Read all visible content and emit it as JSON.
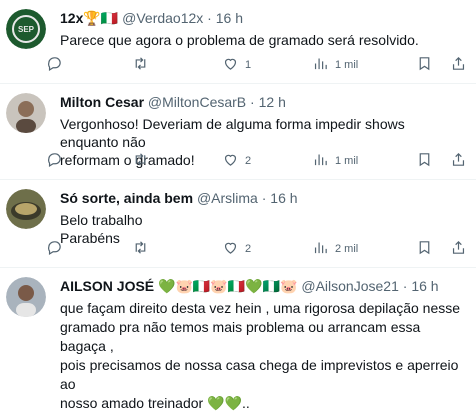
{
  "tweets": [
    {
      "name": "12x🏆🇮🇹",
      "handle": "@Verdao12x",
      "time": "16 h",
      "text": [
        "Parece que agora o problema de gramado será resolvido."
      ],
      "replies": "",
      "retweets": "",
      "likes": "1",
      "views": "1 mil"
    },
    {
      "name": "Milton Cesar",
      "handle": "@MiltonCesarB",
      "time": "12 h",
      "text": [
        "Vergonhoso! Deveriam de alguma forma impedir shows enquanto não",
        "reformam o gramado!"
      ],
      "replies": "",
      "retweets": "",
      "likes": "2",
      "views": "1 mil"
    },
    {
      "name": "Só sorte, ainda bem",
      "handle": "@Arslima",
      "time": "16 h",
      "text": [
        "Belo trabalho",
        "Parabéns"
      ],
      "replies": "",
      "retweets": "",
      "likes": "2",
      "views": "2 mil"
    },
    {
      "name": "AILSON JOSÉ 💚🐷🇮🇹🐷🇮🇹💚🇳🇬🐷",
      "handle": "@AilsonJose21",
      "time": "16 h",
      "text": [
        "que façam direito desta vez hein , uma rigorosa depilação nesse",
        "gramado pra não temos mais problema ou arrancam essa bagaça ,",
        "pois precisamos de nossa casa chega de imprevistos e aperreio ao",
        "nosso amado treinador 💚💚.."
      ],
      "replies": "",
      "retweets": "",
      "likes": "",
      "views": ""
    }
  ],
  "separator": "·",
  "icons": {
    "reply": "reply-icon",
    "retweet": "retweet-icon",
    "like": "heart-icon",
    "views": "views-icon",
    "bookmark": "bookmark-icon",
    "share": "share-icon"
  },
  "colors": {
    "text": "#0f1419",
    "secondary": "#536471",
    "divider": "#eff3f4",
    "palmeiras_green": "#1d5a2e"
  }
}
